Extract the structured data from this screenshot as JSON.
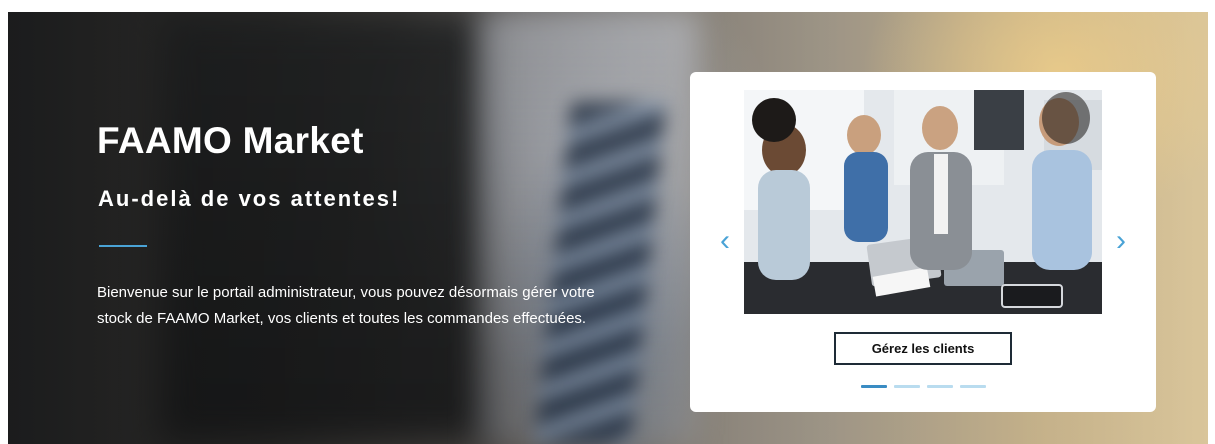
{
  "hero": {
    "title": "FAAMO Market",
    "subtitle": "Au-delà de vos attentes!",
    "description": "Bienvenue sur le portail administrateur, vous pouvez désormais gérer votre stock de FAAMO Market, vos clients et toutes les commandes effectuées."
  },
  "carousel": {
    "prev_icon": "‹",
    "next_icon": "›",
    "button_label": "Gérez les clients",
    "slide_count": 4,
    "active_index": 0
  },
  "colors": {
    "accent": "#4aa3d6",
    "indicator_active": "#3a8cc3",
    "indicator_inactive": "#b9dcef",
    "button_border": "#1e2b36"
  }
}
